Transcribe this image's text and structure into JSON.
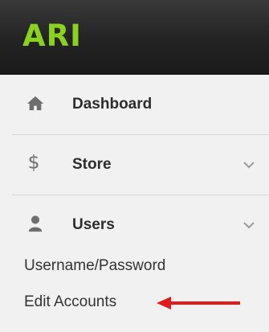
{
  "app": {
    "logo": "ARI"
  },
  "nav": {
    "items": [
      {
        "label": "Dashboard",
        "icon": "home-icon"
      },
      {
        "label": "Store",
        "icon": "dollar-icon",
        "expanded": false
      },
      {
        "label": "Users",
        "icon": "user-icon",
        "expanded": true
      }
    ],
    "submenu": [
      {
        "label": "Username/Password"
      },
      {
        "label": "Edit Accounts"
      }
    ]
  },
  "colors": {
    "brand_green": "#8bd11f",
    "annotation_arrow": "#e11b1b"
  }
}
